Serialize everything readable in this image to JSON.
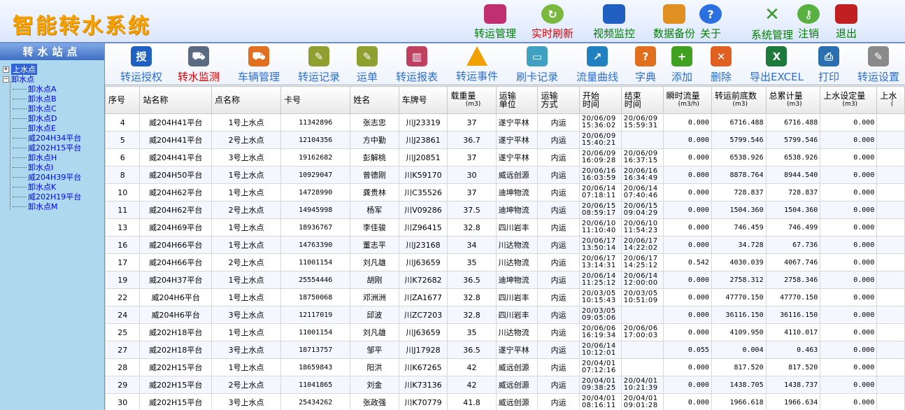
{
  "app": {
    "title": "智能转水系统"
  },
  "header_buttons": [
    {
      "label": "转运管理",
      "icon": "truck-icon",
      "color": "#c03070"
    },
    {
      "label": "实时刷新",
      "icon": "refresh-icon",
      "color": "#7ab840",
      "red": true
    },
    {
      "label": "视频监控",
      "icon": "video-camera-icon",
      "color": "#2060c0"
    },
    {
      "label": "数据备份",
      "icon": "backup-icon",
      "color": "#e09020"
    },
    {
      "label": "关于",
      "icon": "help-icon",
      "color": "#2a70e0"
    },
    {
      "label": "系统管理",
      "icon": "tools-icon",
      "color": "#3a9a30"
    },
    {
      "label": "注销",
      "icon": "key-icon",
      "color": "#58b040"
    },
    {
      "label": "退出",
      "icon": "exit-door-icon",
      "color": "#c02020"
    }
  ],
  "sidebar": {
    "title": "转水站点",
    "root_up": "上水点",
    "root_down": "卸水点",
    "children": [
      "卸水点A",
      "卸水点B",
      "卸水点C",
      "卸水点D",
      "卸水点E",
      "威204H34平台",
      "威202H15平台",
      "卸水点H",
      "卸水点I",
      "威204H39平台",
      "卸水点K",
      "威202H19平台",
      "卸水点M"
    ]
  },
  "toolbar": [
    {
      "label": "转运授权",
      "icon": "authorize-icon",
      "glyph": "授",
      "color": "#2060c0"
    },
    {
      "label": "转水监测",
      "icon": "monitor-truck-icon",
      "glyph": "⛟",
      "color": "#5a6a80",
      "red": true
    },
    {
      "label": "车辆管理",
      "icon": "tanker-truck-icon",
      "glyph": "⛟",
      "color": "#e07020"
    },
    {
      "label": "转运记录",
      "icon": "record-icon",
      "glyph": "✎",
      "color": "#90a030"
    },
    {
      "label": "运单",
      "icon": "waybill-icon",
      "glyph": "✎",
      "color": "#90a030"
    },
    {
      "label": "转运报表",
      "icon": "report-chart-icon",
      "glyph": "▥",
      "color": "#c04060"
    },
    {
      "label": "转运事件",
      "icon": "warning-icon",
      "glyph": "!",
      "color": "#f0a000"
    },
    {
      "label": "刷卡记录",
      "icon": "card-icon",
      "glyph": "▭",
      "color": "#40a0c0"
    },
    {
      "label": "流量曲线",
      "icon": "flow-chart-icon",
      "glyph": "↗",
      "color": "#2080c0"
    },
    {
      "label": "字典",
      "icon": "dictionary-icon",
      "glyph": "?",
      "color": "#e07020"
    },
    {
      "label": "添加",
      "icon": "add-icon",
      "glyph": "+",
      "color": "#40a020"
    },
    {
      "label": "删除",
      "icon": "delete-icon",
      "glyph": "✕",
      "color": "#e06020"
    },
    {
      "label": "导出EXCEL",
      "icon": "excel-icon",
      "glyph": "X",
      "color": "#1e7a3a"
    },
    {
      "label": "打印",
      "icon": "printer-icon",
      "glyph": "⎙",
      "color": "#2a70b0"
    },
    {
      "label": "转运设置",
      "icon": "settings-edit-icon",
      "glyph": "✎",
      "color": "#8a8a8a"
    }
  ],
  "table": {
    "headers": [
      {
        "l1": "序号"
      },
      {
        "l1": "站名称"
      },
      {
        "l1": "点名称"
      },
      {
        "l1": "卡号"
      },
      {
        "l1": "姓名"
      },
      {
        "l1": "车牌号"
      },
      {
        "l1": "载重量",
        "u": "(m3)"
      },
      {
        "l1": "运输",
        "l2": "单位"
      },
      {
        "l1": "运输",
        "l2": "方式"
      },
      {
        "l1": "开始",
        "l2": "时间"
      },
      {
        "l1": "结束",
        "l2": "时间"
      },
      {
        "l1": "瞬时流量",
        "u": "(m3/h)"
      },
      {
        "l1": "转运前底数",
        "u": "(m3)"
      },
      {
        "l1": "总累计量",
        "u": "(m3)"
      },
      {
        "l1": "上水设定量",
        "u": "(m3)"
      },
      {
        "l1": "上水",
        "u": "("
      }
    ],
    "rows": [
      [
        "4",
        "威204H41平台",
        "1号上水点",
        "11342896",
        "张志忠",
        "川J23319",
        "37",
        "遂宁平林",
        "内运",
        "20/06/09",
        "15:36:02",
        "20/06/09",
        "15:59:31",
        "0.000",
        "6716.488",
        "6716.488",
        "0.000"
      ],
      [
        "5",
        "威204H41平台",
        "2号上水点",
        "12104356",
        "方中勤",
        "川J23861",
        "36.7",
        "遂宁平林",
        "内运",
        "20/06/09",
        "15:40:21",
        "",
        "",
        "0.000",
        "5799.546",
        "5799.546",
        "0.000"
      ],
      [
        "6",
        "威204H41平台",
        "3号上水点",
        "19162682",
        "彭解桃",
        "川J20851",
        "37",
        "遂宁平林",
        "内运",
        "20/06/09",
        "16:09:28",
        "20/06/09",
        "16:37:15",
        "0.000",
        "6538.926",
        "6538.926",
        "0.000"
      ],
      [
        "8",
        "威204H50平台",
        "1号上水点",
        "10929047",
        "曾德刚",
        "川K59170",
        "30",
        "威远创源",
        "内运",
        "20/06/16",
        "16:03:59",
        "20/06/16",
        "16:34:49",
        "0.000",
        "8878.764",
        "8944.540",
        "0.000"
      ],
      [
        "10",
        "威204H62平台",
        "1号上水点",
        "14728990",
        "龚贵林",
        "川C35526",
        "37",
        "迪坤物流",
        "内运",
        "20/06/14",
        "07:18:11",
        "20/06/14",
        "07:40:46",
        "0.000",
        "728.837",
        "728.837",
        "0.000"
      ],
      [
        "11",
        "威204H62平台",
        "2号上水点",
        "14945998",
        "杨军",
        "川V09286",
        "37.5",
        "迪坤物流",
        "内运",
        "20/06/15",
        "08:59:17",
        "20/06/15",
        "09:04:29",
        "0.000",
        "1504.360",
        "1504.360",
        "0.000"
      ],
      [
        "13",
        "威204H69平台",
        "1号上水点",
        "18936767",
        "李佳骏",
        "川Z96415",
        "32.8",
        "四川岩丰",
        "内运",
        "20/06/10",
        "11:10:40",
        "20/06/10",
        "11:54:23",
        "0.000",
        "746.459",
        "746.499",
        "0.000"
      ],
      [
        "16",
        "威204H66平台",
        "1号上水点",
        "14763390",
        "董志平",
        "川J23168",
        "34",
        "川达物流",
        "内运",
        "20/06/17",
        "13:50:14",
        "20/06/17",
        "14:22:02",
        "0.000",
        "34.728",
        "67.736",
        "0.000"
      ],
      [
        "17",
        "威204H66平台",
        "2号上水点",
        "11001154",
        "刘凡雄",
        "川J63659",
        "35",
        "川达物流",
        "内运",
        "20/06/17",
        "13:14:31",
        "20/06/17",
        "14:25:12",
        "0.542",
        "4030.039",
        "4067.746",
        "0.000"
      ],
      [
        "19",
        "威204H37平台",
        "1号上水点",
        "25554446",
        "胡刚",
        "川K72682",
        "36.5",
        "迪坤物流",
        "内运",
        "20/06/14",
        "11:25:12",
        "20/06/14",
        "12:00:00",
        "0.000",
        "2758.312",
        "2758.346",
        "0.000"
      ],
      [
        "22",
        "威204H6平台",
        "1号上水点",
        "18750068",
        "邓洲洲",
        "川ZA1677",
        "32.8",
        "四川岩丰",
        "内运",
        "20/03/05",
        "10:15:43",
        "20/03/05",
        "10:51:09",
        "0.000",
        "47770.150",
        "47770.150",
        "0.000"
      ],
      [
        "24",
        "威204H6平台",
        "3号上水点",
        "12117019",
        "邱波",
        "川ZC7203",
        "32.8",
        "四川岩丰",
        "内运",
        "20/03/05",
        "09:05:06",
        "",
        "",
        "0.000",
        "36116.150",
        "36116.150",
        "0.000"
      ],
      [
        "25",
        "威202H18平台",
        "1号上水点",
        "11001154",
        "刘凡雄",
        "川J63659",
        "35",
        "川达物流",
        "内运",
        "20/06/06",
        "16:19:34",
        "20/06/06",
        "17:00:03",
        "0.000",
        "4109.950",
        "4110.017",
        "0.000"
      ],
      [
        "27",
        "威202H18平台",
        "3号上水点",
        "18713757",
        "邹平",
        "川J17928",
        "36.5",
        "遂宁平林",
        "内运",
        "20/06/14",
        "10:12:01",
        "",
        "",
        "0.055",
        "0.004",
        "0.463",
        "0.000"
      ],
      [
        "28",
        "威202H15平台",
        "1号上水点",
        "18659843",
        "阳洪",
        "川K67265",
        "42",
        "威远创源",
        "内运",
        "20/04/01",
        "07:12:16",
        "",
        "",
        "0.000",
        "817.520",
        "817.520",
        "0.000"
      ],
      [
        "29",
        "威202H15平台",
        "2号上水点",
        "11041865",
        "刘金",
        "川K73136",
        "42",
        "威远创源",
        "内运",
        "20/04/01",
        "09:38:25",
        "20/04/01",
        "10:21:39",
        "0.000",
        "1438.705",
        "1438.737",
        "0.000"
      ],
      [
        "30",
        "威202H15平台",
        "3号上水点",
        "25434262",
        "张政强",
        "川K70779",
        "41.8",
        "威远创源",
        "内运",
        "20/04/01",
        "08:16:11",
        "20/04/01",
        "09:01:28",
        "0.000",
        "1966.618",
        "1966.634",
        "0.000"
      ]
    ]
  }
}
